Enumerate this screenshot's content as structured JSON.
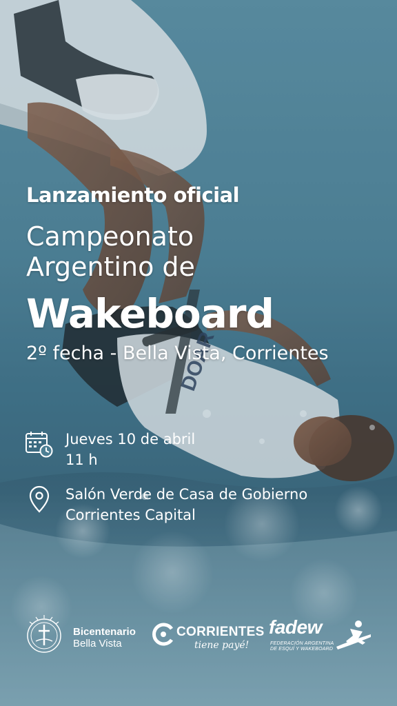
{
  "headline": {
    "kicker": "Lanzamiento oficial",
    "title_line1": "Campeonato",
    "title_line2": "Argentino de",
    "title_line3": "Wakeboard",
    "subtitle": "2º fecha - Bella Vista, Corrientes"
  },
  "event": {
    "date_icon": "calendar-clock-icon",
    "date": "Jueves 10 de abril",
    "time": "11 h",
    "place_icon": "location-pin-icon",
    "venue": "Salón Verde de Casa de Gobierno",
    "city": "Corrientes Capital"
  },
  "logos": {
    "bicentenario_line1": "Bicentenario",
    "bicentenario_line2": "Bella Vista",
    "corrientes_word": "CORRIENTES",
    "corrientes_tagline": "tiene payé!",
    "fadew_word": "fadew",
    "fadew_sub_line1": "FEDERACIÓN ARGENTINA",
    "fadew_sub_line2": "DE ESQUÍ Y WAKEBOARD"
  },
  "colors": {
    "text": "#ffffff",
    "water_top": "#5d8fa3",
    "water_bottom": "#3a657a"
  }
}
